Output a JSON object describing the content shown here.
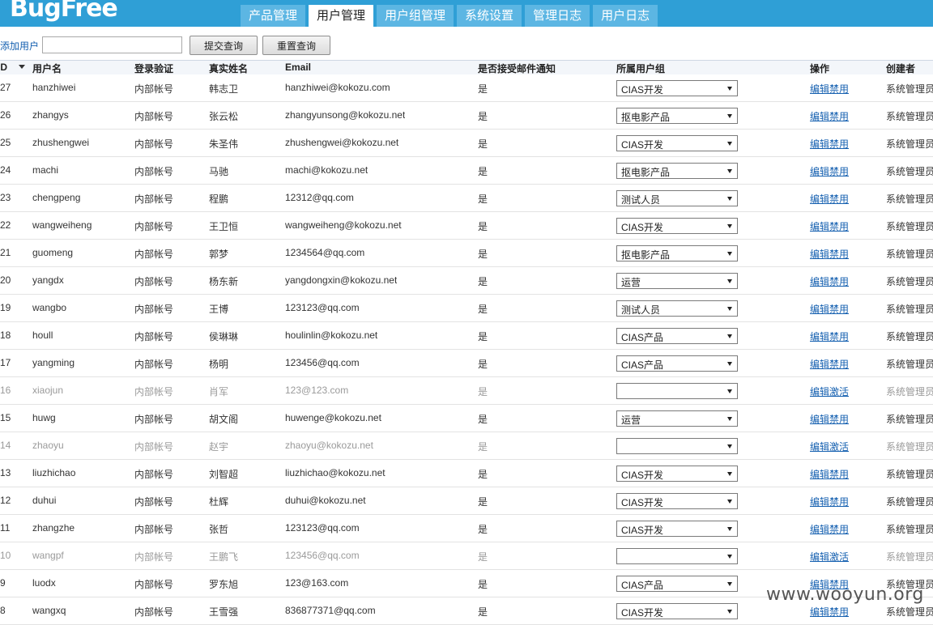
{
  "app": {
    "logo": "BugFree"
  },
  "nav": {
    "tabs": [
      {
        "label": "产品管理",
        "active": false
      },
      {
        "label": "用户管理",
        "active": true
      },
      {
        "label": "用户组管理",
        "active": false
      },
      {
        "label": "系统设置",
        "active": false
      },
      {
        "label": "管理日志",
        "active": false
      },
      {
        "label": "用户日志",
        "active": false
      }
    ]
  },
  "toolbar": {
    "add_user_label": "添加用户",
    "search_value": "",
    "submit_label": "提交查询",
    "reset_label": "重置查询"
  },
  "table": {
    "columns": [
      "ID",
      "用户名",
      "登录验证",
      "真实姓名",
      "Email",
      "是否接受邮件通知",
      "所属用户组",
      "操作",
      "创建者"
    ],
    "rows": [
      {
        "id": "27",
        "username": "hanzhiwei",
        "auth": "内部帐号",
        "realname": "韩志卫",
        "email": "hanzhiwei@kokozu.com",
        "notify": "是",
        "group": "CIAS开发",
        "edit": "编辑",
        "toggle": "禁用",
        "creator": "系统管理员",
        "disabled": false
      },
      {
        "id": "26",
        "username": "zhangys",
        "auth": "内部帐号",
        "realname": "张云松",
        "email": "zhangyunsong@kokozu.net",
        "notify": "是",
        "group": "抠电影产品",
        "edit": "编辑",
        "toggle": "禁用",
        "creator": "系统管理员",
        "disabled": false
      },
      {
        "id": "25",
        "username": "zhushengwei",
        "auth": "内部帐号",
        "realname": "朱圣伟",
        "email": "zhushengwei@kokozu.net",
        "notify": "是",
        "group": "CIAS开发",
        "edit": "编辑",
        "toggle": "禁用",
        "creator": "系统管理员",
        "disabled": false
      },
      {
        "id": "24",
        "username": "machi",
        "auth": "内部帐号",
        "realname": "马驰",
        "email": "machi@kokozu.net",
        "notify": "是",
        "group": "抠电影产品",
        "edit": "编辑",
        "toggle": "禁用",
        "creator": "系统管理员",
        "disabled": false
      },
      {
        "id": "23",
        "username": "chengpeng",
        "auth": "内部帐号",
        "realname": "程鹏",
        "email": "12312@qq.com",
        "notify": "是",
        "group": "测试人员",
        "edit": "编辑",
        "toggle": "禁用",
        "creator": "系统管理员",
        "disabled": false
      },
      {
        "id": "22",
        "username": "wangweiheng",
        "auth": "内部帐号",
        "realname": "王卫恒",
        "email": "wangweiheng@kokozu.net",
        "notify": "是",
        "group": "CIAS开发",
        "edit": "编辑",
        "toggle": "禁用",
        "creator": "系统管理员",
        "disabled": false
      },
      {
        "id": "21",
        "username": "guomeng",
        "auth": "内部帐号",
        "realname": "郭梦",
        "email": "1234564@qq.com",
        "notify": "是",
        "group": "抠电影产品",
        "edit": "编辑",
        "toggle": "禁用",
        "creator": "系统管理员",
        "disabled": false
      },
      {
        "id": "20",
        "username": "yangdx",
        "auth": "内部帐号",
        "realname": "杨东新",
        "email": "yangdongxin@kokozu.net",
        "notify": "是",
        "group": "运营",
        "edit": "编辑",
        "toggle": "禁用",
        "creator": "系统管理员",
        "disabled": false
      },
      {
        "id": "19",
        "username": "wangbo",
        "auth": "内部帐号",
        "realname": "王博",
        "email": "123123@qq.com",
        "notify": "是",
        "group": "测试人员",
        "edit": "编辑",
        "toggle": "禁用",
        "creator": "系统管理员",
        "disabled": false
      },
      {
        "id": "18",
        "username": "houll",
        "auth": "内部帐号",
        "realname": "侯琳琳",
        "email": "houlinlin@kokozu.net",
        "notify": "是",
        "group": "CIAS产品",
        "edit": "编辑",
        "toggle": "禁用",
        "creator": "系统管理员",
        "disabled": false
      },
      {
        "id": "17",
        "username": "yangming",
        "auth": "内部帐号",
        "realname": "杨明",
        "email": "123456@qq.com",
        "notify": "是",
        "group": "CIAS产品",
        "edit": "编辑",
        "toggle": "禁用",
        "creator": "系统管理员",
        "disabled": false
      },
      {
        "id": "16",
        "username": "xiaojun",
        "auth": "内部帐号",
        "realname": "肖军",
        "email": "123@123.com",
        "notify": "是",
        "group": "",
        "edit": "编辑",
        "toggle": "激活",
        "creator": "系统管理员",
        "disabled": true
      },
      {
        "id": "15",
        "username": "huwg",
        "auth": "内部帐号",
        "realname": "胡文阁",
        "email": "huwenge@kokozu.net",
        "notify": "是",
        "group": "运营",
        "edit": "编辑",
        "toggle": "禁用",
        "creator": "系统管理员",
        "disabled": false
      },
      {
        "id": "14",
        "username": "zhaoyu",
        "auth": "内部帐号",
        "realname": "赵宇",
        "email": "zhaoyu@kokozu.net",
        "notify": "是",
        "group": "",
        "edit": "编辑",
        "toggle": "激活",
        "creator": "系统管理员",
        "disabled": true
      },
      {
        "id": "13",
        "username": "liuzhichao",
        "auth": "内部帐号",
        "realname": "刘智超",
        "email": "liuzhichao@kokozu.net",
        "notify": "是",
        "group": "CIAS开发",
        "edit": "编辑",
        "toggle": "禁用",
        "creator": "系统管理员",
        "disabled": false
      },
      {
        "id": "12",
        "username": "duhui",
        "auth": "内部帐号",
        "realname": "杜辉",
        "email": "duhui@kokozu.net",
        "notify": "是",
        "group": "CIAS开发",
        "edit": "编辑",
        "toggle": "禁用",
        "creator": "系统管理员",
        "disabled": false
      },
      {
        "id": "11",
        "username": "zhangzhe",
        "auth": "内部帐号",
        "realname": "张哲",
        "email": "123123@qq.com",
        "notify": "是",
        "group": "CIAS开发",
        "edit": "编辑",
        "toggle": "禁用",
        "creator": "系统管理员",
        "disabled": false
      },
      {
        "id": "10",
        "username": "wangpf",
        "auth": "内部帐号",
        "realname": "王鹏飞",
        "email": "123456@qq.com",
        "notify": "是",
        "group": "",
        "edit": "编辑",
        "toggle": "激活",
        "creator": "系统管理员",
        "disabled": true
      },
      {
        "id": "9",
        "username": "luodx",
        "auth": "内部帐号",
        "realname": "罗东旭",
        "email": "123@163.com",
        "notify": "是",
        "group": "CIAS产品",
        "edit": "编辑",
        "toggle": "禁用",
        "creator": "系统管理员",
        "disabled": false
      },
      {
        "id": "8",
        "username": "wangxq",
        "auth": "内部帐号",
        "realname": "王雪强",
        "email": "836877371@qq.com",
        "notify": "是",
        "group": "CIAS开发",
        "edit": "编辑",
        "toggle": "禁用",
        "creator": "系统管理员",
        "disabled": false
      }
    ]
  },
  "watermark": "www.wooyun.org",
  "colors": {
    "topbar": "#2f9fd6",
    "tab_inactive": "#5cb6e3",
    "link": "#1560b0",
    "disabled_text": "#9a9a9a"
  }
}
